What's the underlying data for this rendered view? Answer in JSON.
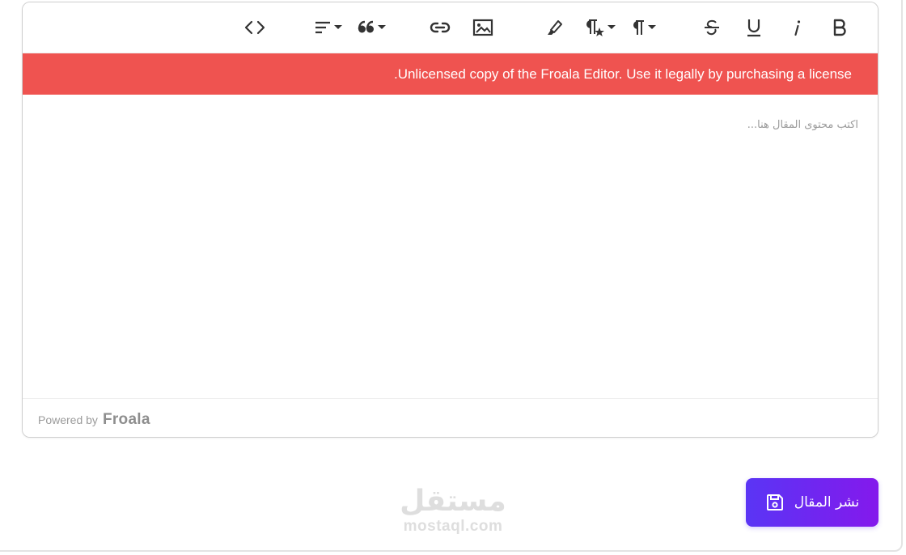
{
  "editor": {
    "banner_text": ".Unlicensed copy of the Froala Editor. Use it legally by purchasing a license",
    "placeholder": "اكتب محتوى المقال هنا...",
    "powered_by": "Powered by",
    "powered_brand": "Froala",
    "banner_color": "#ef5350"
  },
  "toolbar": {
    "buttons": [
      {
        "name": "code-view",
        "icon": "code-icon",
        "dropdown": false
      },
      {
        "name": "align",
        "icon": "align-icon",
        "dropdown": true
      },
      {
        "name": "quote",
        "icon": "quote-icon",
        "dropdown": true
      },
      {
        "name": "insert-link",
        "icon": "link-icon",
        "dropdown": false
      },
      {
        "name": "insert-image",
        "icon": "image-icon",
        "dropdown": false
      },
      {
        "name": "background-color",
        "icon": "highlighter-icon",
        "dropdown": false
      },
      {
        "name": "paragraph-style",
        "icon": "paragraph-style-icon",
        "dropdown": true
      },
      {
        "name": "paragraph-format",
        "icon": "paragraph-icon",
        "dropdown": true
      },
      {
        "name": "strikethrough",
        "icon": "strikethrough-icon",
        "dropdown": false
      },
      {
        "name": "underline",
        "icon": "underline-icon",
        "dropdown": false
      },
      {
        "name": "italic",
        "icon": "italic-icon",
        "dropdown": false
      },
      {
        "name": "bold",
        "icon": "bold-icon",
        "dropdown": false
      }
    ]
  },
  "publish": {
    "label": "نشر المقال",
    "icon": "save-icon",
    "gradient_start": "#5a35f5",
    "gradient_end": "#8419ec"
  },
  "watermark": {
    "arabic": "مستقل",
    "latin": "mostaql.com"
  }
}
